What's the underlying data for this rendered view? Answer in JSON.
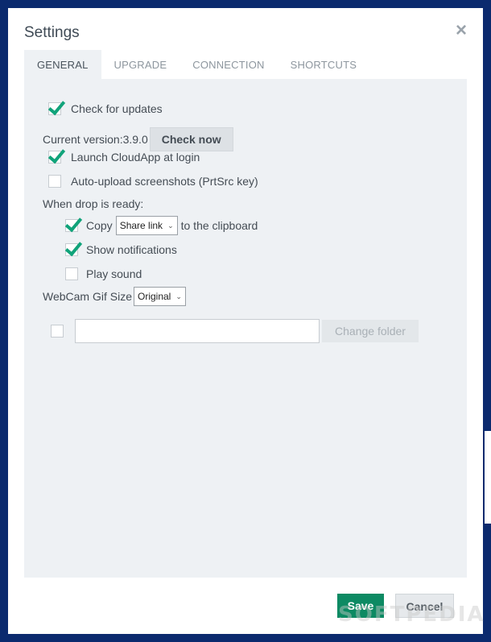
{
  "dialog": {
    "title": "Settings",
    "close_icon": "×",
    "tabs": [
      {
        "label": "GENERAL",
        "active": true
      },
      {
        "label": "UPGRADE",
        "active": false
      },
      {
        "label": "CONNECTION",
        "active": false
      },
      {
        "label": "SHORTCUTS",
        "active": false
      }
    ]
  },
  "general": {
    "check_updates": {
      "label": "Check for updates",
      "checked": true
    },
    "current_version_label": "Current version:",
    "current_version": "3.9.0",
    "check_now_label": "Check now",
    "launch_login": {
      "label": "Launch CloudApp at login",
      "checked": true
    },
    "auto_upload": {
      "label": "Auto-upload screenshots (PrtSrc key)",
      "checked": false
    },
    "drop_ready_label": "When drop is ready:",
    "copy": {
      "label": "Copy",
      "checked": true,
      "select_value": "Share link",
      "suffix": "to the clipboard"
    },
    "show_notifications": {
      "label": "Show notifications",
      "checked": true
    },
    "play_sound": {
      "label": "Play sound",
      "checked": false
    },
    "webcam_gif_label": "WebCam Gif Size",
    "webcam_gif_value": "Original",
    "folder": {
      "checked": false,
      "path_value": "",
      "change_folder_label": "Change folder"
    }
  },
  "footer": {
    "save_label": "Save",
    "cancel_label": "Cancel",
    "watermark": "SOFTPEDIA"
  },
  "colors": {
    "accent": "#10a37a",
    "save_bg": "#0d8a63",
    "background": "#0b2a6e"
  }
}
